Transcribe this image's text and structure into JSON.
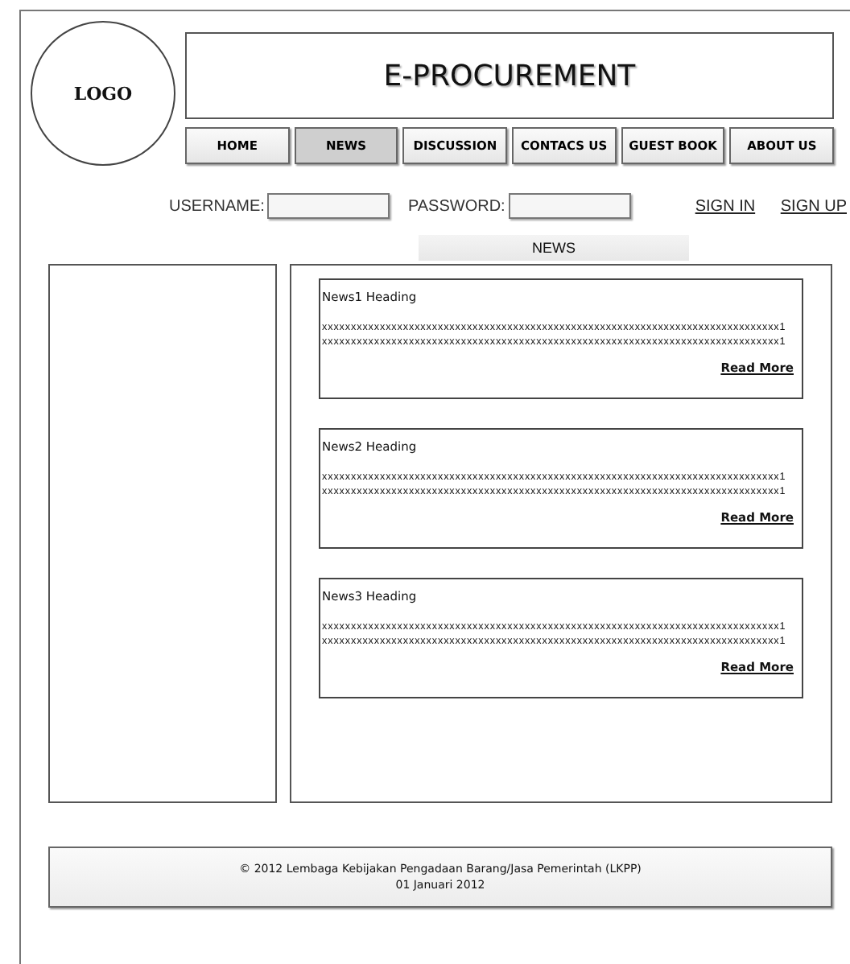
{
  "logo": "LOGO",
  "title": "E-PROCUREMENT",
  "nav": [
    {
      "label": "HOME",
      "selected": false
    },
    {
      "label": "NEWS",
      "selected": true
    },
    {
      "label": "DISCUSSION",
      "selected": false
    },
    {
      "label": "CONTACS US",
      "selected": false
    },
    {
      "label": "GUEST BOOK",
      "selected": false
    },
    {
      "label": "ABOUT US",
      "selected": false
    }
  ],
  "login": {
    "username_label": "USERNAME:",
    "password_label": "PASSWORD:",
    "sign_in": "SIGN IN",
    "sign_up": "SIGN UP"
  },
  "news_header": "NEWS",
  "news": [
    {
      "heading": "News1  Heading",
      "lines": [
        "xxxxxxxxxxxxxxxxxxxxxxxxxxxxxxxxxxxxxxxxxxxxxxxxxxxxxxxxxxxxxxxxxxxxxxxxxxxxxxx1",
        "xxxxxxxxxxxxxxxxxxxxxxxxxxxxxxxxxxxxxxxxxxxxxxxxxxxxxxxxxxxxxxxxxxxxxxxxxxxxxxx1"
      ],
      "link": "Read More"
    },
    {
      "heading": "News2  Heading",
      "lines": [
        "xxxxxxxxxxxxxxxxxxxxxxxxxxxxxxxxxxxxxxxxxxxxxxxxxxxxxxxxxxxxxxxxxxxxxxxxxxxxxxx1",
        "xxxxxxxxxxxxxxxxxxxxxxxxxxxxxxxxxxxxxxxxxxxxxxxxxxxxxxxxxxxxxxxxxxxxxxxxxxxxxxx1"
      ],
      "link": "Read More"
    },
    {
      "heading": "News3  Heading",
      "lines": [
        "xxxxxxxxxxxxxxxxxxxxxxxxxxxxxxxxxxxxxxxxxxxxxxxxxxxxxxxxxxxxxxxxxxxxxxxxxxxxxxx1",
        "xxxxxxxxxxxxxxxxxxxxxxxxxxxxxxxxxxxxxxxxxxxxxxxxxxxxxxxxxxxxxxxxxxxxxxxxxxxxxxx1"
      ],
      "link": "Read More"
    }
  ],
  "footer": [
    "© 2012 Lembaga Kebijakan Pengadaan Barang/Jasa Pemerintah (LKPP)",
    "01 Januari 2012"
  ]
}
